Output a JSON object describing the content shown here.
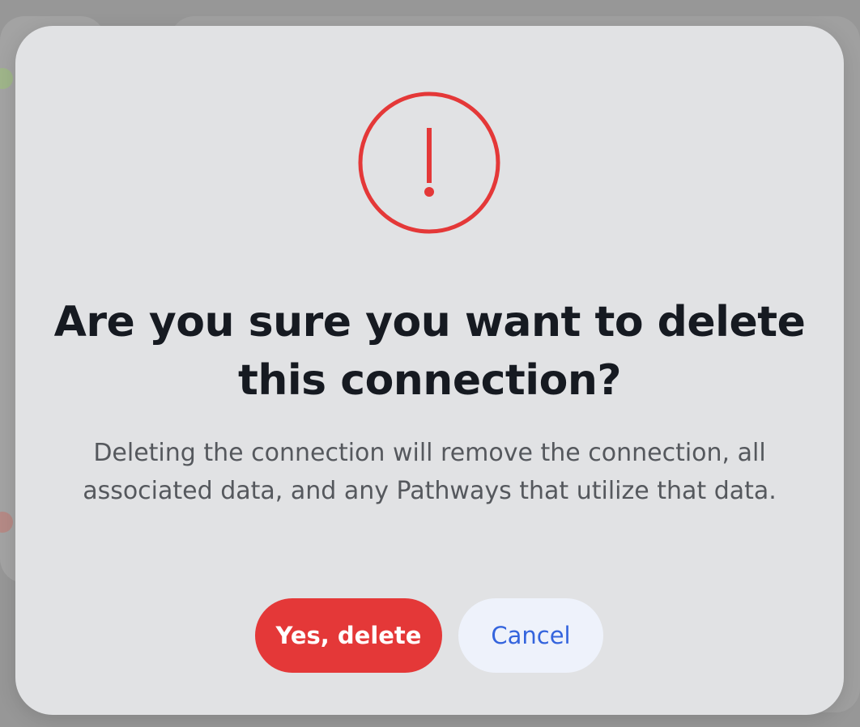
{
  "dialog": {
    "icon": "exclamation-circle-icon",
    "title": "Are you sure you want to delete this connection?",
    "description": "Deleting the connection will remove the connection, all associated data, and any Pathways that utilize that data.",
    "confirm_label": "Yes, delete",
    "cancel_label": "Cancel"
  },
  "colors": {
    "danger": "#e43838",
    "cancel_bg": "#eef2fb",
    "cancel_text": "#3464dd",
    "title_text": "#161a21",
    "body_text": "#55585d",
    "modal_bg": "#e1e2e4"
  }
}
